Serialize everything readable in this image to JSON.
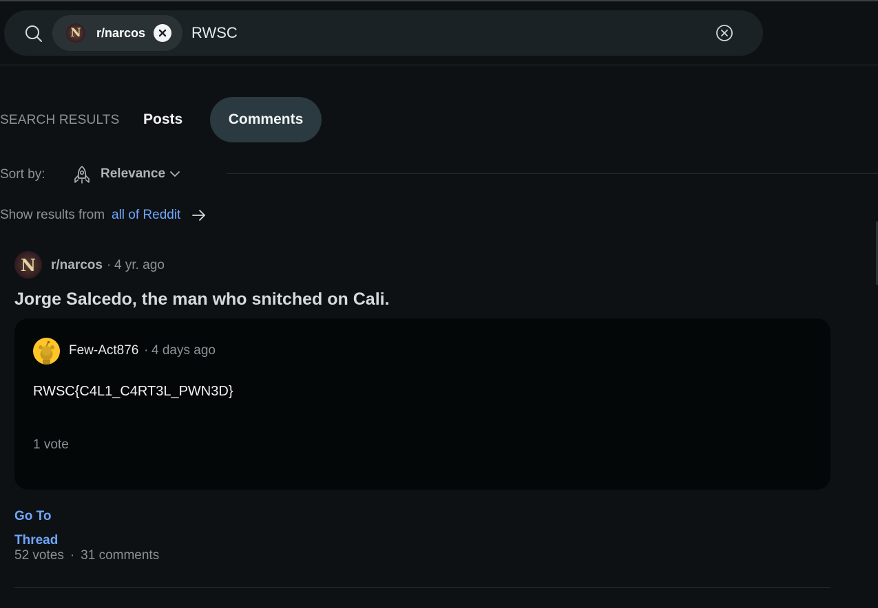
{
  "search": {
    "community_chip": {
      "avatar_letter": "N",
      "label": "r/narcos"
    },
    "query": "RWSC"
  },
  "tabs": {
    "heading": "SEARCH RESULTS",
    "items": [
      {
        "label": "Posts",
        "selected": false
      },
      {
        "label": "Comments",
        "selected": true
      }
    ]
  },
  "sort": {
    "label": "Sort by:",
    "value": "Relevance"
  },
  "scope": {
    "label": "Show results from",
    "link": "all of Reddit"
  },
  "result": {
    "subreddit": {
      "avatar_letter": "N",
      "name": "r/narcos",
      "separator": "·",
      "age": "4 yr. ago"
    },
    "post_title": "Jorge Salcedo, the man who snitched on Cali.",
    "comment": {
      "username": "Few-Act876",
      "separator": "·",
      "age": "4 days ago",
      "body": "RWSC{C4L1_C4RT3L_PWN3D}",
      "votes": "1 vote"
    },
    "goto_line1": "Go To",
    "goto_line2": "Thread",
    "post_votes": "52 votes",
    "stats_separator": "·",
    "post_comments": "31 comments"
  },
  "colors": {
    "background": "#0e1113",
    "link": "#6ea6ff",
    "chip": "#2a3236",
    "selected_tab": "#2a3a40",
    "card": "#040707",
    "user_avatar": "#ffc529"
  }
}
